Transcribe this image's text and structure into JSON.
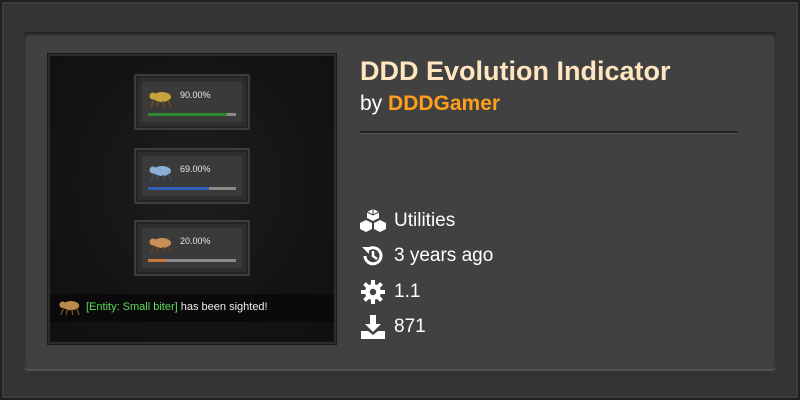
{
  "mod": {
    "title": "DDD Evolution Indicator",
    "by_prefix": "by",
    "author": "DDDGamer",
    "category": "Utilities",
    "updated": "3 years ago",
    "version": "1.1",
    "downloads": "871"
  },
  "thumbnail": {
    "indicators": [
      {
        "percent_label": "90.00%",
        "fill_fraction": 0.9,
        "bar_color": "#2d8a2d",
        "biter_color": "#c4a23c"
      },
      {
        "percent_label": "69.00%",
        "fill_fraction": 0.69,
        "bar_color": "#2f5fb8",
        "biter_color": "#8aaed6"
      },
      {
        "percent_label": "20.00%",
        "fill_fraction": 0.2,
        "bar_color": "#c8783a",
        "biter_color": "#c89056"
      }
    ],
    "message": {
      "entity": "[Entity: Small biter]",
      "suffix": " has been sighted!"
    }
  },
  "icons": {
    "category": "cubes-icon",
    "updated": "history-icon",
    "version": "gear-icon",
    "downloads": "download-icon"
  },
  "colors": {
    "title": "#ffe6c0",
    "author": "#ff9f1c",
    "entity_text": "#62d95e"
  }
}
